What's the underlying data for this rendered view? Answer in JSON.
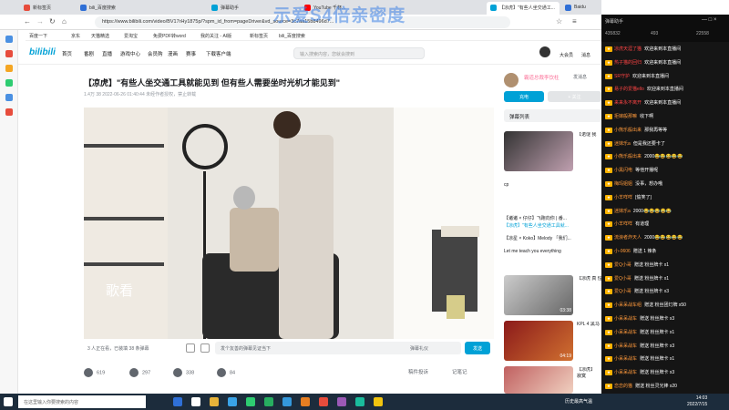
{
  "browser": {
    "tabs": [
      {
        "label": "新标签页"
      },
      {
        "label": "bili_百度搜索"
      },
      {
        "label": "弹幕助手"
      },
      {
        "label": "YouTube 千杯..."
      },
      {
        "label": "【凉虎】\"有些人坐交通工..."
      },
      {
        "label": "Baidu"
      }
    ],
    "url": "https://www.bilibili.com/video/BV17rHy1875p/?spm_id_from=pageDriver&vd_source=3c7aa15b8496d7...",
    "bookmarks": [
      "百度一下",
      "京东",
      "天猫精选",
      "爱淘宝",
      "免费PDF转word",
      "我的关注 - AI版",
      "新标签页",
      "bili_百度搜索"
    ]
  },
  "watermark": "示爱S4倍亲密度",
  "bili": {
    "nav": [
      "首页",
      "番剧",
      "直播",
      "游戏中心",
      "会员购",
      "漫画",
      "赛事",
      "下载客户端"
    ],
    "search_placeholder": "输入搜索内容，您就会搜到",
    "header_right": [
      "大会员",
      "消息"
    ],
    "title": "【凉虎】\"有些人坐交通工具就能见到 但有些人需要坐时光机才能见到\"",
    "meta": "1.4万   38   2022-06-26 01:40:44   未经作者授权，禁止转载",
    "player_caption": "歌看",
    "danmaku": {
      "viewers": "3 人正在看，已装填 38 条弹幕",
      "placeholder": "发个友善的弹幕见证当下",
      "etiquette": "弹幕礼仪",
      "send": "发送"
    },
    "actions": [
      {
        "label": "619",
        "icon": "like-icon"
      },
      {
        "label": "297",
        "icon": "coin-icon"
      },
      {
        "label": "338",
        "icon": "star-icon"
      },
      {
        "label": "84",
        "icon": "share-icon"
      }
    ],
    "action_right": [
      "稿件投诉",
      "记笔记"
    ],
    "up": {
      "name": "霸道总裁李饮柱",
      "message": "发消息",
      "follow": "充电",
      "follow2": "+ 关注"
    },
    "danmaku_list": "弹幕列表",
    "recs": [
      {
        "title": "【诺谜 我",
        "duration": ""
      },
      {
        "title": "cp",
        "duration": ""
      },
      {
        "title": "【凉虎 真 恒",
        "duration": "03:38"
      },
      {
        "title": "KPL 4 黑马",
        "duration": "04:19"
      },
      {
        "title": "【凉虎】\n寂寞",
        "duration": ""
      }
    ],
    "rec_lines": [
      "【诸诸 × 仔仔】飞跑向你 | 番...",
      "【凉虎】\"有些人坐交通工具就...",
      "【凉星 × Koko】Melody 「我们...",
      "Let me teach you everything"
    ],
    "bottom_rec": "【凉虎】欢天小山河！ 一个小\n寂寞"
  },
  "chat": {
    "header": "弹幕助手",
    "stats": [
      "435832",
      "493",
      "22558"
    ],
    "lines": [
      {
        "user": "凉虎天涯了猫",
        "text": "欢迎来到本直播间"
      },
      {
        "user": "热子猫的回归",
        "text": "欢迎来到本直播间"
      },
      {
        "user": "SR守护",
        "text": "欢迎来到本直播间"
      },
      {
        "user": "易子的爱猫ello",
        "text": "欢迎来到本直播间"
      },
      {
        "user": "来来永不离开",
        "text": "欢迎来到本直播间"
      },
      {
        "user": "拒嫁般那嘛",
        "text": "收下啊"
      },
      {
        "user": "小熊乐般出来",
        "text": "那我再等等"
      },
      {
        "user": "迷妹乐a",
        "text": "但是我还要卡了"
      },
      {
        "user": "小熊乐般出来",
        "text": "2000😂😂😂😂😂"
      },
      {
        "user": "小黑闪电",
        "text": "等他开播呢"
      },
      {
        "user": "梅玛姐姐",
        "text": "没事，想办哦"
      },
      {
        "user": "小羊咩咩",
        "text": "[偷笑了]"
      },
      {
        "user": "迷妹乐a",
        "text": "2000😂😂😂😂😂"
      },
      {
        "user": "小羊咩咩",
        "text": "有道理"
      },
      {
        "user": "流浪者炸天人",
        "text": "2000😂😂😂😂😂"
      },
      {
        "user": "小-0606",
        "text": "赠送 1 辣条"
      },
      {
        "user": "爱Q小哥",
        "text": "赠送 粉丝牌卡 x1"
      },
      {
        "user": "爱Q小哥",
        "text": "赠送 粉丝牌卡 x1"
      },
      {
        "user": "爱Q小哥",
        "text": "赠送 粉丝牌卡 x3"
      },
      {
        "user": "小呆呆战车组",
        "text": "赠送 粉丝团灯牌 x50"
      },
      {
        "user": "小呆呆战车",
        "text": "赠送 粉丝牌卡 x3"
      },
      {
        "user": "小呆呆战车",
        "text": "赠送 粉丝牌卡 x1"
      },
      {
        "user": "小呆呆战车",
        "text": "赠送 粉丝牌卡 x3"
      },
      {
        "user": "小呆呆战车",
        "text": "赠送 粉丝牌卡 x1"
      },
      {
        "user": "小呆呆战车",
        "text": "赠送 粉丝牌卡 x3"
      },
      {
        "user": "恋恋的猫",
        "text": "赠送 粉丝灵光棒 x20"
      }
    ]
  },
  "taskbar": {
    "search": "在这里输入你要搜索的内容",
    "weather": "历史最高气温",
    "time": "14:03",
    "date": "2022/7/15"
  },
  "colors": {
    "accent": "#00a1d6",
    "chat_bg": "#151515",
    "taskbar": "#1c2c3c"
  }
}
